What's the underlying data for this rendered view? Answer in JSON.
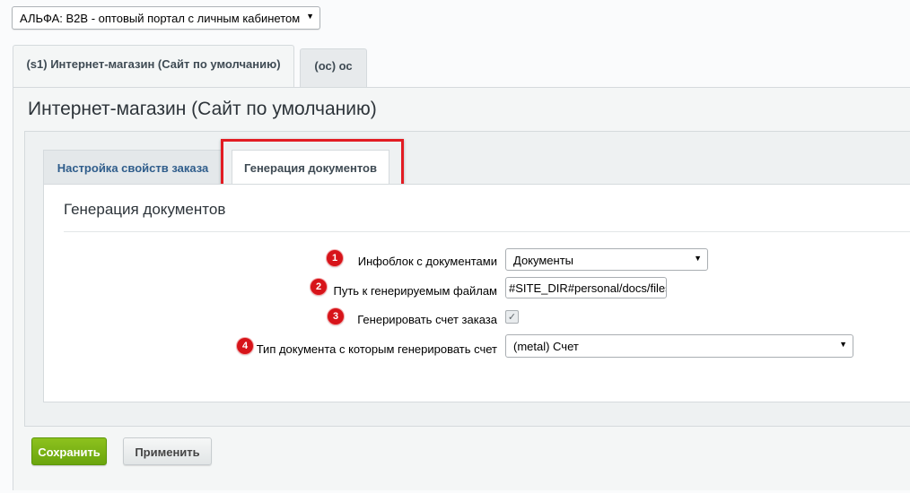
{
  "site_selector": {
    "value": "АЛЬФА: B2B - оптовый портал с личным кабинетом",
    "arrow": "▼"
  },
  "outer_tabs": [
    {
      "label": "(s1) Интернет-магазин (Сайт по умолчанию)",
      "active": true
    },
    {
      "label": "(ос) ос",
      "active": false
    }
  ],
  "panel": {
    "title": "Интернет-магазин (Сайт по умолчанию)"
  },
  "inner_tabs": [
    {
      "label": "Настройка свойств заказа",
      "active": false
    },
    {
      "label": "Генерация документов",
      "active": true
    }
  ],
  "section": {
    "title": "Генерация документов"
  },
  "fields": [
    {
      "marker": "1",
      "label": "Инфоблок с документами",
      "type": "select",
      "value": "Документы"
    },
    {
      "marker": "2",
      "label": "Путь к генерируемым файлам",
      "type": "text",
      "value": "#SITE_DIR#personal/docs/files/"
    },
    {
      "marker": "3",
      "label": "Генерировать счет заказа",
      "type": "checkbox",
      "checked": true
    },
    {
      "marker": "4",
      "label": "Тип документа с которым генерировать счет",
      "type": "select",
      "value": "(metal) Счет"
    }
  ],
  "buttons": {
    "save": "Сохранить",
    "apply": "Применить"
  },
  "colors": {
    "highlight": "#e21c23",
    "marker": "#d7141a",
    "save_button": "#7bb316",
    "link_tab": "#2f5d8b"
  }
}
